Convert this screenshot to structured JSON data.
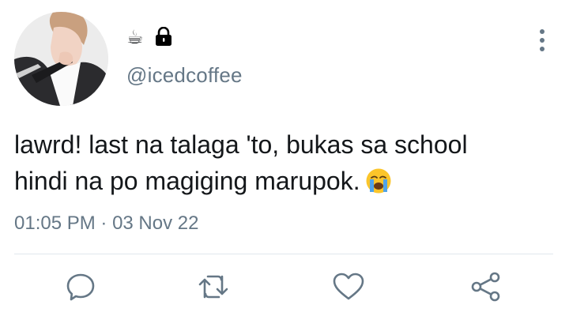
{
  "tweet": {
    "display_name_emoji": "☕",
    "handle": "@icedcoffee",
    "text_lines": [
      "lawrd! last na talaga 'to, bukas sa school",
      "hindi na po magiging marupok."
    ],
    "text_emoji": "loudly-crying-face",
    "time": "01:05 PM",
    "separator": " · ",
    "date": "03 Nov 22",
    "locked": true
  },
  "icons": {
    "lock": "lock-icon",
    "more": "more-vertical-icon",
    "reply": "reply-icon",
    "retweet": "retweet-icon",
    "like": "heart-icon",
    "share": "share-icon"
  },
  "colors": {
    "text": "#14171a",
    "secondary": "#657786",
    "divider": "#e1e8ed",
    "emoji": "#fbc52a"
  }
}
